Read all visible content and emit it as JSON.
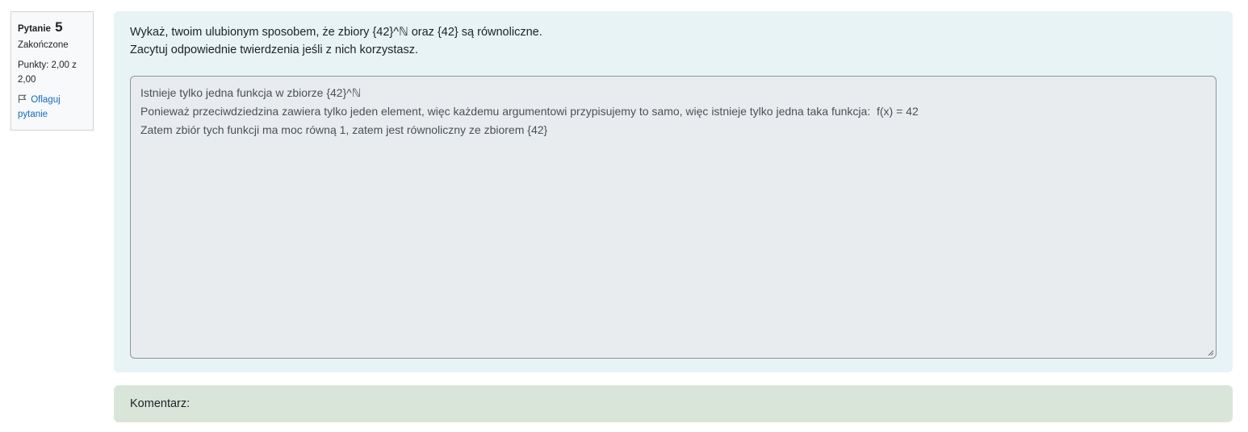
{
  "info": {
    "question_label": "Pytanie",
    "question_number": "5",
    "state": "Zakończone",
    "grade_line1": "Punkty: 2,00 z",
    "grade_line2": "2,00",
    "flag_line1": "Oflaguj",
    "flag_line2": "pytanie",
    "flag_icon": "flag-icon"
  },
  "question": {
    "line1": "Wykaż, twoim ulubionym sposobem, że zbiory {42}^ℕ oraz {42} są równoliczne.",
    "line2": "Zacytuj odpowiednie twierdzenia jeśli z nich korzystasz."
  },
  "answer": {
    "lines": [
      "Istnieje tylko jedna funkcja w zbiorze {42}^ℕ",
      "Ponieważ przeciwdziedzina zawiera tylko jeden element, więc każdemu argumentowi przypisujemy to samo, więc istnieje tylko jedna taka funkcja:  f(x) = 42",
      "Zatem zbiór tych funkcji ma moc równą 1, zatem jest równoliczny ze zbiorem {42}"
    ]
  },
  "comment": {
    "label": "Komentarz:"
  }
}
